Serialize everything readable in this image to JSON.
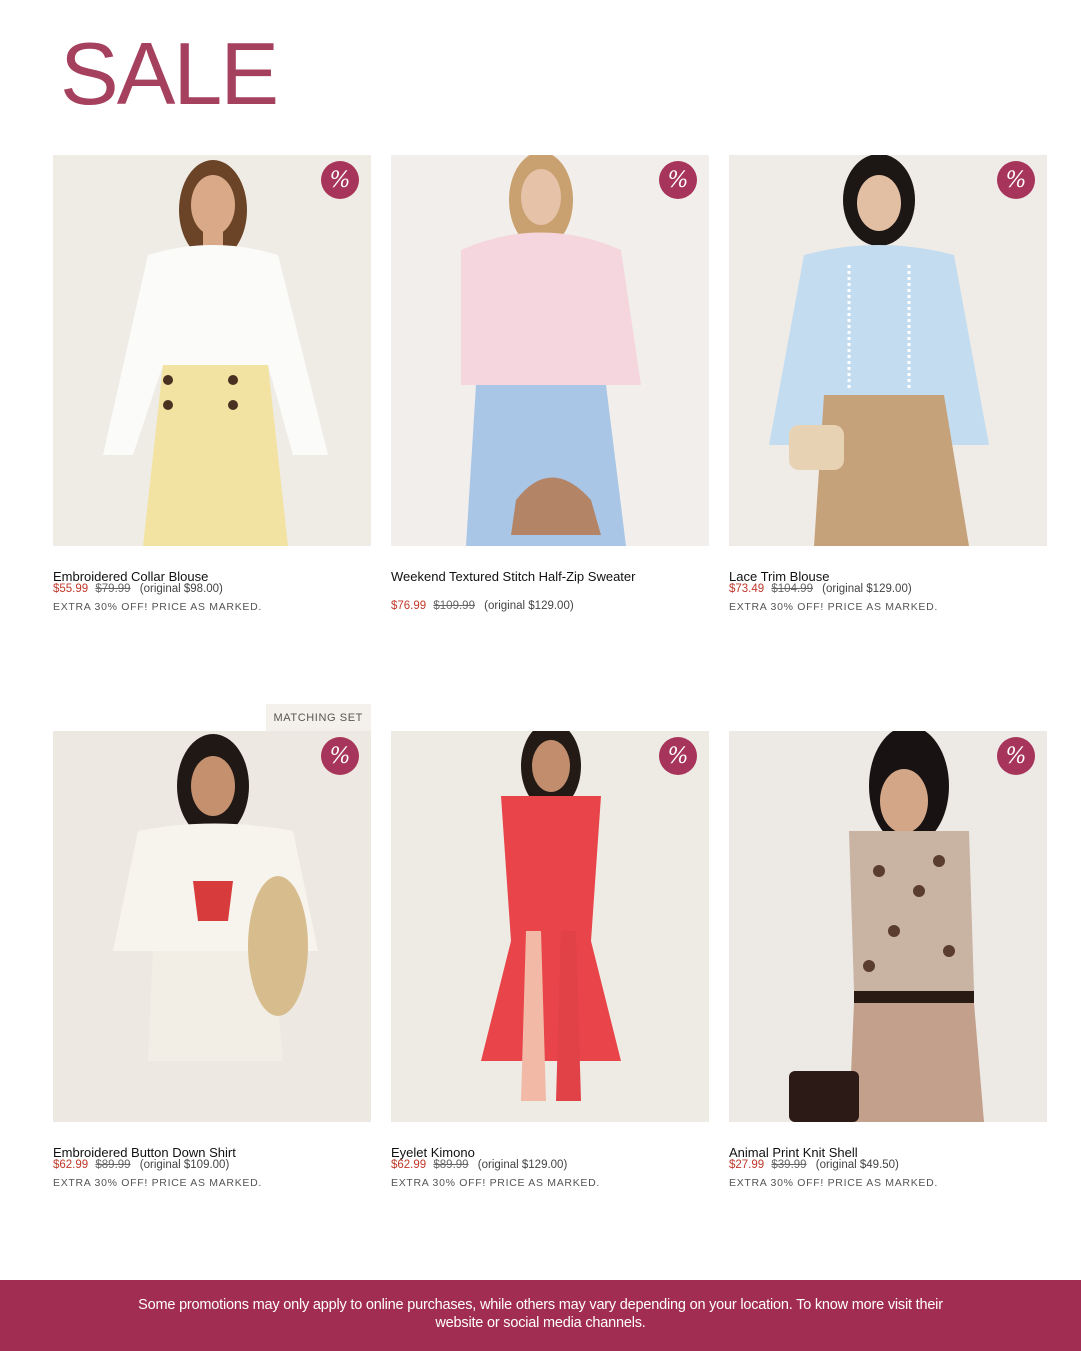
{
  "header": {
    "title": "SALE"
  },
  "badge_symbol": "%",
  "products": [
    {
      "name": "Embroidered Collar Blouse",
      "sale_price": "$55.99",
      "was_price": "$79.99",
      "original": "(original $98.00)",
      "promo": "EXTRA 30% OFF! PRICE AS MARKED.",
      "colors": {
        "background": "#efece6",
        "top": "#fbfbf9",
        "bottom": "#f2e3a3",
        "skin": "#d9a988",
        "hair": "#6b4428"
      }
    },
    {
      "name": "Weekend Textured Stitch Half-Zip Sweater",
      "sale_price": "$76.99",
      "was_price": "$109.99",
      "original": "(original $129.00)",
      "promo": "",
      "colors": {
        "background": "#f1eeeb",
        "top": "#f6d6de",
        "bottom": "#a9c6e6",
        "skin": "#e6c2a8",
        "hair": "#c9a170"
      }
    },
    {
      "name": "Lace Trim Blouse",
      "sale_price": "$73.49",
      "was_price": "$104.99",
      "original": "(original $129.00)",
      "promo": "EXTRA 30% OFF! PRICE AS MARKED.",
      "colors": {
        "background": "#efece8",
        "top": "#c4dcef",
        "bottom": "#c6a27b",
        "skin": "#e2bfa3",
        "hair": "#1c1614"
      }
    },
    {
      "name": "Embroidered Button Down Shirt",
      "sale_price": "$62.99",
      "was_price": "$89.99",
      "original": "(original $109.00)",
      "promo": "EXTRA 30% OFF! PRICE AS MARKED.",
      "tag": "MATCHING SET",
      "colors": {
        "background": "#ede9e2",
        "top": "#f7f4ee",
        "bottom": "#f2eee6",
        "skin": "#c4906d",
        "hair": "#1f1814"
      }
    },
    {
      "name": "Eyelet Kimono",
      "sale_price": "$62.99",
      "was_price": "$89.99",
      "original": "(original $129.00)",
      "promo": "EXTRA 30% OFF! PRICE AS MARKED.",
      "colors": {
        "background": "#eeeae4",
        "top": "#e8444a",
        "bottom": "#e14247",
        "skin": "#c18d6c",
        "hair": "#231a16"
      }
    },
    {
      "name": "Animal Print Knit Shell",
      "sale_price": "$27.99",
      "was_price": "$39.99",
      "original": "(original $49.50)",
      "promo": "EXTRA 30% OFF! PRICE AS MARKED.",
      "colors": {
        "background": "#edeae6",
        "top": "#c9b3a3",
        "bottom": "#c3a08c",
        "skin": "#d3a687",
        "hair": "#181312"
      }
    }
  ],
  "footer": {
    "line1": "Some promotions may only apply to online purchases, while others may vary depending on your location. To know more visit their",
    "line2": "website or social media channels."
  }
}
